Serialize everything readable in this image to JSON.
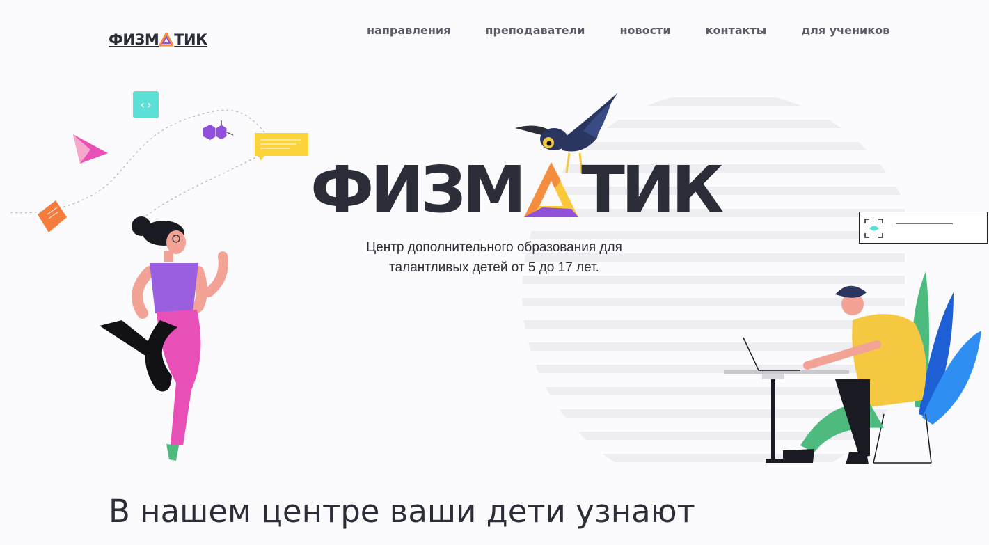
{
  "header": {
    "logo_text_left": "ФИЗМ",
    "logo_text_right": "ТИК",
    "nav": [
      {
        "label": "направления"
      },
      {
        "label": "преподаватели"
      },
      {
        "label": "новости"
      },
      {
        "label": "контакты"
      },
      {
        "label": "для учеников"
      }
    ]
  },
  "hero": {
    "logo_text_left": "ФИЗМ",
    "logo_text_right": "ТИК",
    "tagline_line1": "Центр дополнительного образования для",
    "tagline_line2": "талантливых детей от 5 до 17 лет.",
    "code_chip": "‹›"
  },
  "section": {
    "title": "В нашем центре ваши дети узнают"
  },
  "colors": {
    "text": "#2b2d38",
    "nav": "#5a5b66",
    "triangle_orange": "#f58d3f",
    "triangle_purple": "#9050d9",
    "triangle_yellow": "#fbc83b",
    "teal": "#5ce0d6",
    "pink": "#e84fb7",
    "yellow": "#fbd33b"
  },
  "icons": [
    "triangle-logo-icon",
    "code-brackets-icon",
    "molecule-icon",
    "note-icon",
    "scan-frame-icon",
    "crow-illustration",
    "woman-illustration",
    "man-laptop-illustration",
    "plant-illustration"
  ]
}
